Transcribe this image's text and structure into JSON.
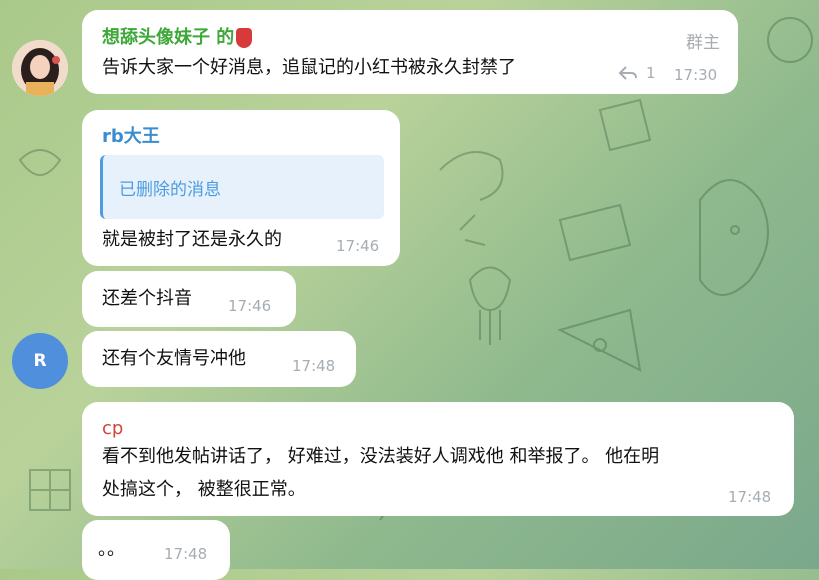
{
  "messages": {
    "m1": {
      "sender": "想舔头像妹子 的",
      "sender_color": "#3fa83a",
      "badge": "群主",
      "text": "告诉大家一个好消息，追鼠记的小红书被永久封禁了",
      "reply_count": "1",
      "time": "17:30"
    },
    "m2": {
      "sender": "rb大王",
      "sender_color": "#3a8ccf",
      "reply_text": "已删除的消息",
      "text": "就是被封了还是永久的",
      "time": "17:46"
    },
    "m3": {
      "text": "还差个抖音",
      "time": "17:46"
    },
    "m4": {
      "text": "还有个友情号冲他",
      "time": "17:48"
    },
    "m5": {
      "sender": "cp",
      "sender_color": "#d2463a",
      "line1": "看不到他发帖讲话了，  好难过，没法装好人调戏他 和举报了。 他在明",
      "line2": "处搞这个，  被整很正常。",
      "time": "17:48"
    },
    "m6": {
      "text": "。。",
      "time": "17:48"
    }
  },
  "avatars": {
    "r_letter": "R"
  }
}
